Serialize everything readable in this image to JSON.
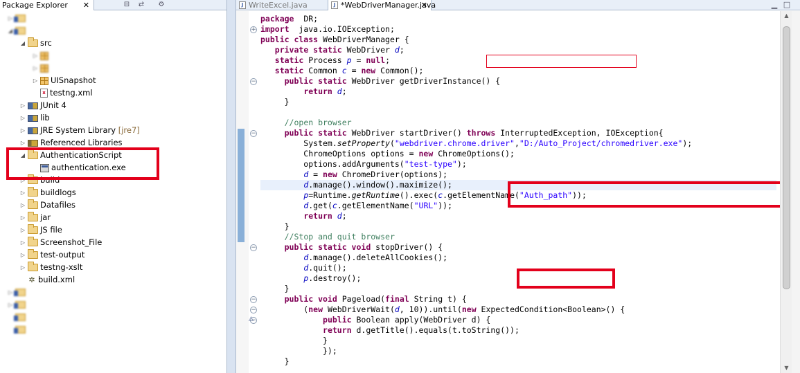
{
  "package_explorer": {
    "title": "Package Explorer",
    "close_glyph": "✕",
    "toolbar_icons": [
      "collapse-all-icon",
      "link-with-editor-icon",
      "view-menu-icon"
    ],
    "items": [
      {
        "label": "",
        "icon": "project-icon",
        "arrow": "collapsed",
        "blurred": true
      },
      {
        "label": "",
        "icon": "project-icon",
        "arrow": "expanded",
        "blurred": true
      },
      {
        "label": "src",
        "icon": "source-folder-icon",
        "arrow": "expanded"
      },
      {
        "label": "",
        "icon": "package-icon",
        "arrow": "collapsed",
        "blurred": true
      },
      {
        "label": "",
        "icon": "package-icon",
        "arrow": "collapsed",
        "blurred": true
      },
      {
        "label": "UISnapshot",
        "icon": "package-icon",
        "arrow": "collapsed"
      },
      {
        "label": "testng.xml",
        "icon": "xml-file-icon",
        "arrow": "none"
      },
      {
        "label": "JUnit 4",
        "icon": "library-icon",
        "arrow": "collapsed"
      },
      {
        "label": "lib",
        "icon": "library-icon",
        "arrow": "collapsed"
      },
      {
        "label": "JRE System Library",
        "decoration": "[jre7]",
        "icon": "library-icon",
        "arrow": "collapsed"
      },
      {
        "label": "Referenced Libraries",
        "icon": "jar-icon",
        "arrow": "collapsed"
      },
      {
        "label": "AuthenticationScript",
        "icon": "folder-icon",
        "arrow": "expanded"
      },
      {
        "label": "authentication.exe",
        "icon": "exe-file-icon",
        "arrow": "none"
      },
      {
        "label": "build",
        "icon": "folder-icon",
        "arrow": "collapsed"
      },
      {
        "label": "buildlogs",
        "icon": "folder-icon",
        "arrow": "collapsed"
      },
      {
        "label": "Datafiles",
        "icon": "folder-icon",
        "arrow": "collapsed"
      },
      {
        "label": "jar",
        "icon": "folder-icon",
        "arrow": "collapsed"
      },
      {
        "label": "JS file",
        "icon": "folder-icon",
        "arrow": "collapsed"
      },
      {
        "label": "Screenshot_File",
        "icon": "folder-icon",
        "arrow": "collapsed"
      },
      {
        "label": "test-output",
        "icon": "folder-icon",
        "arrow": "collapsed"
      },
      {
        "label": "testng-xslt",
        "icon": "folder-icon",
        "arrow": "collapsed"
      },
      {
        "label": "build.xml",
        "icon": "ant-file-icon",
        "arrow": "none"
      },
      {
        "label": "",
        "icon": "project-icon",
        "arrow": "collapsed",
        "blurred": true
      },
      {
        "label": "",
        "icon": "project-icon",
        "arrow": "collapsed",
        "blurred": true
      },
      {
        "label": "",
        "icon": "project-icon",
        "arrow": "none",
        "blurred": true
      },
      {
        "label": "",
        "icon": "project-icon",
        "arrow": "none",
        "blurred": true
      }
    ]
  },
  "editor": {
    "tabs": [
      {
        "label": "WriteExcel.java",
        "active": false
      },
      {
        "label": "*WebDriverManager.java",
        "active": true
      }
    ],
    "close_glyph": "✕",
    "window_buttons": [
      "minimize-icon",
      "maximize-icon"
    ],
    "code_lines": [
      [
        [
          "kw",
          "package"
        ],
        [
          "",
          "  DR;"
        ]
      ],
      [
        [
          "kw",
          "import"
        ],
        [
          "",
          "  java.io.IOException;"
        ]
      ],
      [
        [
          "kw",
          "public class"
        ],
        [
          "",
          " WebDriverManager {"
        ]
      ],
      [
        [
          "",
          "   "
        ],
        [
          "kw",
          "private static"
        ],
        [
          "",
          " WebDriver "
        ],
        [
          "fld",
          "d"
        ],
        [
          "",
          ";"
        ]
      ],
      [
        [
          "",
          "   "
        ],
        [
          "kw",
          "static"
        ],
        [
          "",
          " Process "
        ],
        [
          "fld",
          "p"
        ],
        [
          "",
          " = "
        ],
        [
          "kw",
          "null"
        ],
        [
          "",
          ";"
        ]
      ],
      [
        [
          "",
          "   "
        ],
        [
          "kw",
          "static"
        ],
        [
          "",
          " Common "
        ],
        [
          "fld",
          "c"
        ],
        [
          "",
          " = "
        ],
        [
          "kw",
          "new"
        ],
        [
          "",
          " Common();"
        ]
      ],
      [
        [
          "",
          "     "
        ],
        [
          "kw",
          "public static"
        ],
        [
          "",
          " WebDriver getDriverInstance() {"
        ]
      ],
      [
        [
          "",
          "         "
        ],
        [
          "kw",
          "return"
        ],
        [
          "",
          " "
        ],
        [
          "fld",
          "d"
        ],
        [
          "",
          ";"
        ]
      ],
      [
        [
          "",
          "     }"
        ]
      ],
      [
        [
          "",
          ""
        ]
      ],
      [
        [
          "",
          "     "
        ],
        [
          "cmt",
          "//open browser"
        ]
      ],
      [
        [
          "",
          "     "
        ],
        [
          "kw",
          "public static"
        ],
        [
          "",
          " WebDriver startDriver() "
        ],
        [
          "kw",
          "throws"
        ],
        [
          "",
          " InterruptedException, IOException{"
        ]
      ],
      [
        [
          "",
          "         System."
        ],
        [
          "it",
          "setProperty"
        ],
        [
          "",
          "("
        ],
        [
          "str",
          "\"webdriver.chrome.driver\""
        ],
        [
          "",
          ","
        ],
        [
          "str",
          "\"D:/Auto_Project/chromedriver.exe\""
        ],
        [
          "",
          ");"
        ]
      ],
      [
        [
          "",
          "         ChromeOptions options = "
        ],
        [
          "kw",
          "new"
        ],
        [
          "",
          " ChromeOptions();"
        ]
      ],
      [
        [
          "",
          "         options.addArguments("
        ],
        [
          "str",
          "\"test-type\""
        ],
        [
          "",
          ");"
        ]
      ],
      [
        [
          "",
          "         "
        ],
        [
          "fld",
          "d"
        ],
        [
          "",
          " = "
        ],
        [
          "kw",
          "new"
        ],
        [
          "",
          " ChromeDriver(options);"
        ]
      ],
      [
        [
          "",
          "         "
        ],
        [
          "fld",
          "d"
        ],
        [
          "",
          ".manage().window().maximize();"
        ]
      ],
      [
        [
          "",
          "         "
        ],
        [
          "fld",
          "p"
        ],
        [
          "",
          "=Runtime."
        ],
        [
          "it",
          "getRuntime"
        ],
        [
          "",
          "().exec("
        ],
        [
          "fld",
          "c"
        ],
        [
          "",
          ".getElementName("
        ],
        [
          "str",
          "\"Auth_path\""
        ],
        [
          "",
          "));"
        ]
      ],
      [
        [
          "",
          "         "
        ],
        [
          "fld",
          "d"
        ],
        [
          "",
          ".get("
        ],
        [
          "fld",
          "c"
        ],
        [
          "",
          ".getElementName("
        ],
        [
          "str",
          "\"URL\""
        ],
        [
          "",
          "));"
        ]
      ],
      [
        [
          "",
          "         "
        ],
        [
          "kw",
          "return"
        ],
        [
          "",
          " "
        ],
        [
          "fld",
          "d"
        ],
        [
          "",
          ";"
        ]
      ],
      [
        [
          "",
          "     }"
        ]
      ],
      [
        [
          "",
          "     "
        ],
        [
          "cmt",
          "//Stop and quit browser"
        ]
      ],
      [
        [
          "",
          "     "
        ],
        [
          "kw",
          "public static void"
        ],
        [
          "",
          " stopDriver() {"
        ]
      ],
      [
        [
          "",
          "         "
        ],
        [
          "fld",
          "d"
        ],
        [
          "",
          ".manage().deleteAllCookies();"
        ]
      ],
      [
        [
          "",
          "         "
        ],
        [
          "fld",
          "d"
        ],
        [
          "",
          ".quit();"
        ]
      ],
      [
        [
          "",
          "         "
        ],
        [
          "fld",
          "p"
        ],
        [
          "",
          ".destroy();"
        ]
      ],
      [
        [
          "",
          "     }"
        ]
      ],
      [
        [
          "",
          "     "
        ],
        [
          "kw",
          "public void"
        ],
        [
          "",
          " Pageload("
        ],
        [
          "kw",
          "final"
        ],
        [
          "",
          " String t) {"
        ]
      ],
      [
        [
          "",
          "         ("
        ],
        [
          "kw",
          "new"
        ],
        [
          "",
          " WebDriverWait("
        ],
        [
          "fld",
          "d"
        ],
        [
          "",
          ", 10)).until("
        ],
        [
          "kw",
          "new"
        ],
        [
          "",
          " ExpectedCondition<Boolean>() {"
        ]
      ],
      [
        [
          "",
          "             "
        ],
        [
          "kw",
          "public"
        ],
        [
          "",
          " Boolean apply(WebDriver d) {"
        ]
      ],
      [
        [
          "",
          "             "
        ],
        [
          "kw",
          "return"
        ],
        [
          "",
          " d.getTitle().equals(t.toString());"
        ]
      ],
      [
        [
          "",
          "             }"
        ]
      ],
      [
        [
          "",
          "             });"
        ]
      ],
      [
        [
          "",
          "     }"
        ]
      ]
    ]
  }
}
